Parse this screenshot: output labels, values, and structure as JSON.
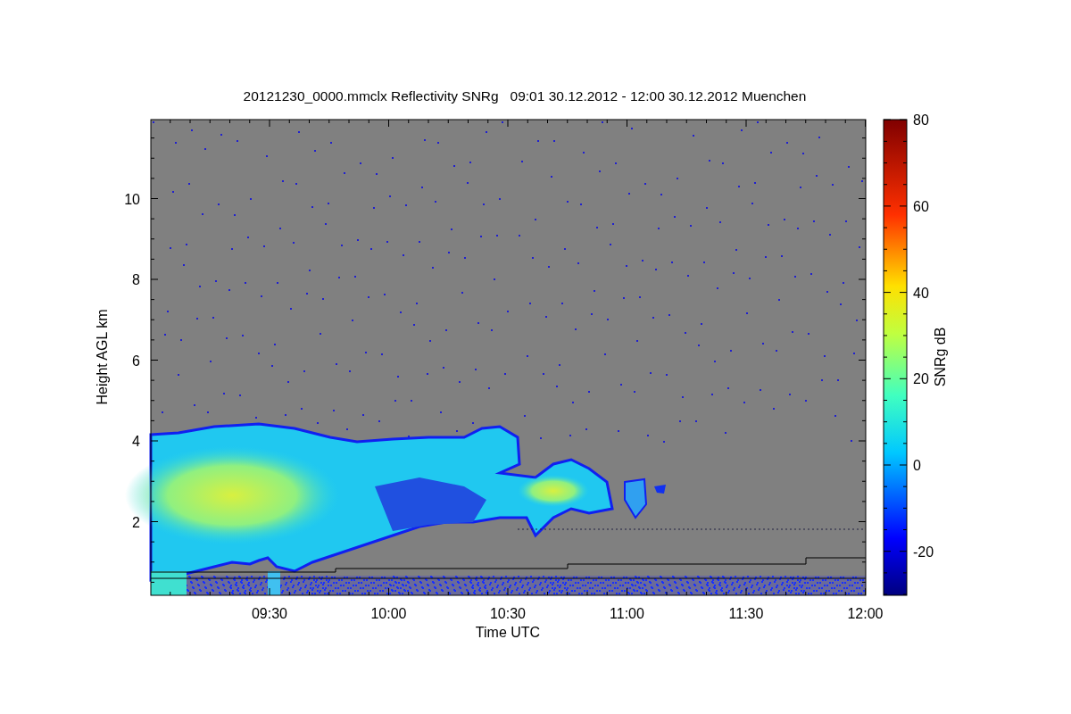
{
  "title": "20121230_0000.mmclx Reflectivity SNRg   09:01 30.12.2012 - 12:00 30.12.2012 Muenchen",
  "plot": {
    "ylabel": "Height AGL km",
    "yticks": [
      "10",
      "8",
      "6",
      "4",
      "2"
    ],
    "xlabel": "Time UTC",
    "xticks": [
      "09:30",
      "10:00",
      "10:30",
      "11:00",
      "11:30",
      "12:00"
    ]
  },
  "colorbar": {
    "label": "SNRg dB",
    "ticks": [
      "80",
      "60",
      "40",
      "20",
      "0",
      "-20"
    ]
  }
}
